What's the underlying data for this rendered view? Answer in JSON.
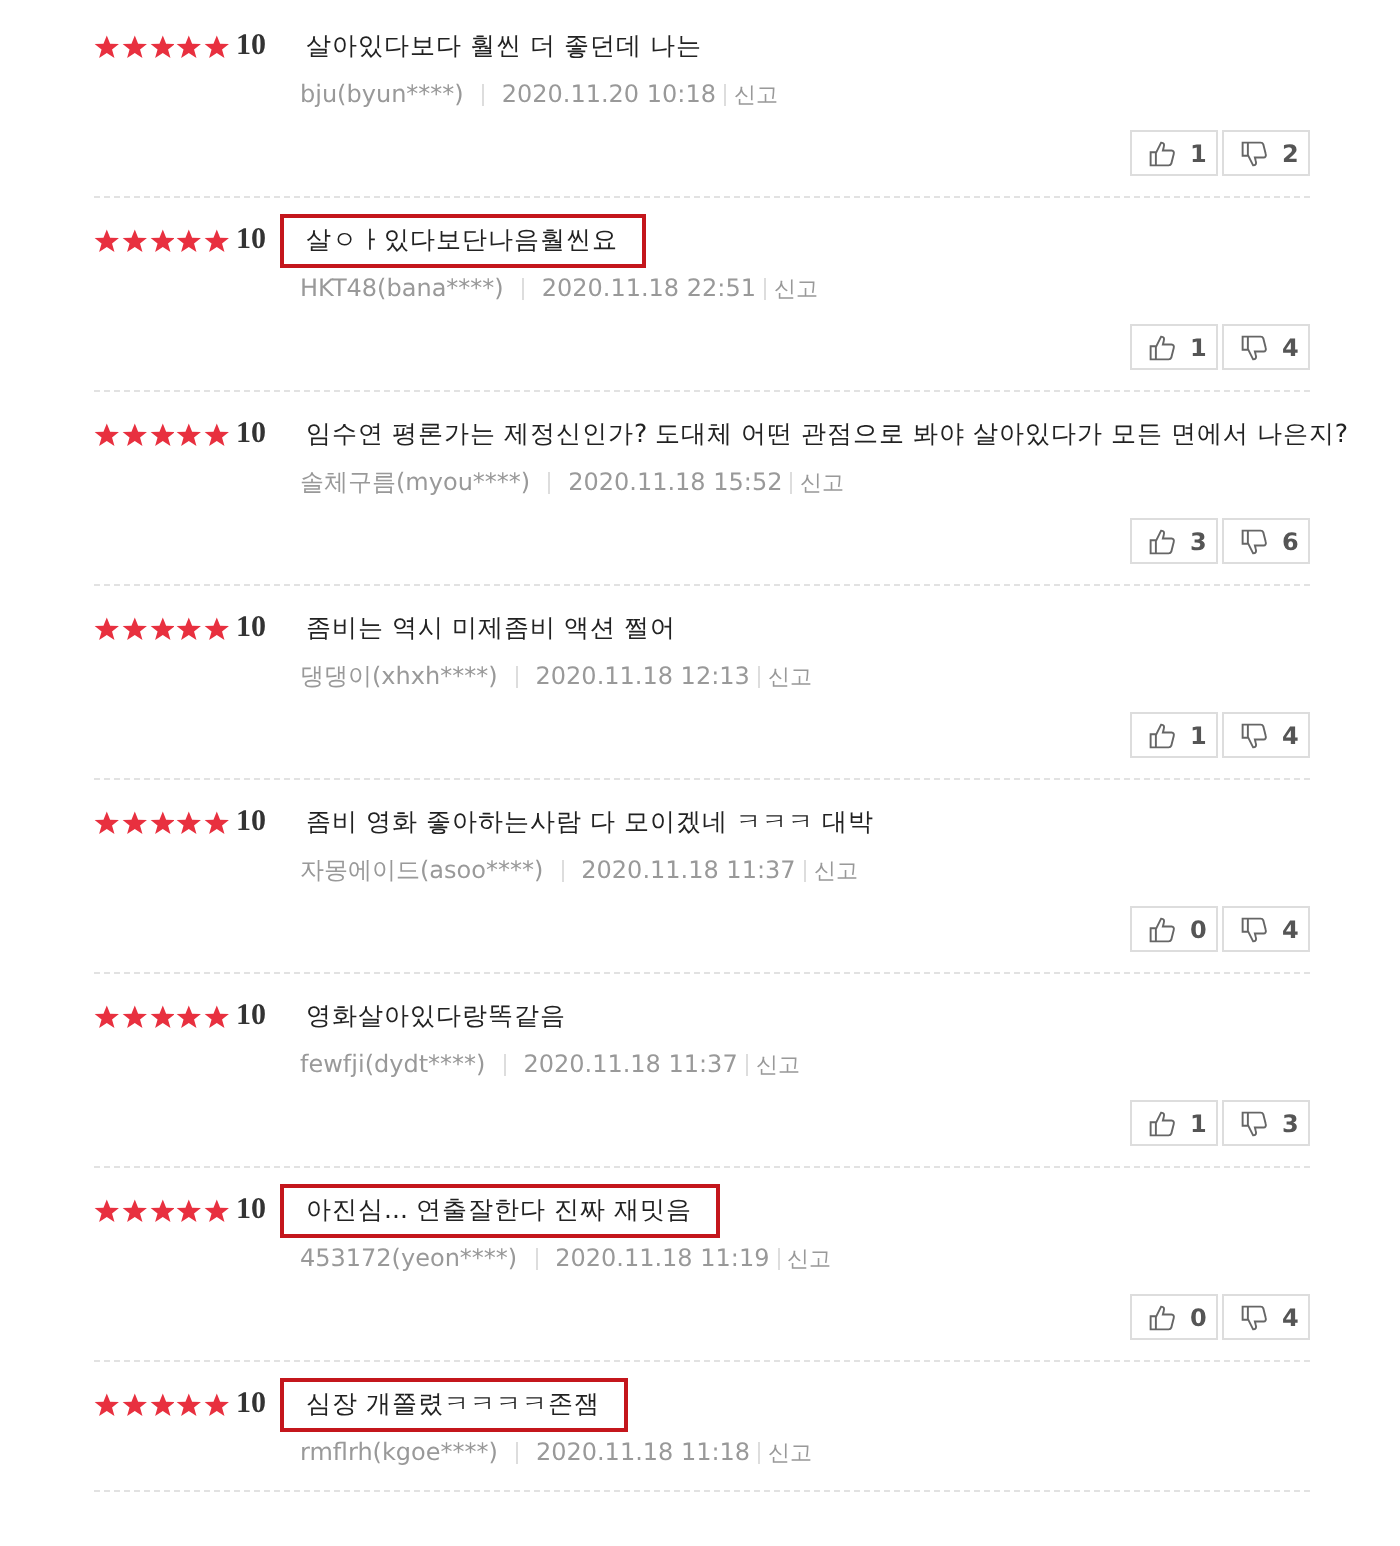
{
  "reviews": [
    {
      "stars": 5,
      "score": "10",
      "comment": "살아있다보다 훨씬 더 좋던데 나는",
      "highlighted": false,
      "author": "bju(byun****)",
      "date": "2020.11.20 10:18",
      "report": "신고",
      "likes": "1",
      "dislikes": "2"
    },
    {
      "stars": 5,
      "score": "10",
      "comment": "살ㅇㅏ있다보단나음훨씬요",
      "highlighted": true,
      "author": "HKT48(bana****)",
      "date": "2020.11.18 22:51",
      "report": "신고",
      "likes": "1",
      "dislikes": "4"
    },
    {
      "stars": 5,
      "score": "10",
      "comment": "임수연 평론가는 제정신인가? 도대체 어떤 관점으로 봐야 살아있다가 모든 면에서 나은지?",
      "highlighted": false,
      "author": "솔체구름(myou****)",
      "date": "2020.11.18 15:52",
      "report": "신고",
      "likes": "3",
      "dislikes": "6"
    },
    {
      "stars": 5,
      "score": "10",
      "comment": "좀비는 역시 미제좀비 액션 쩔어",
      "highlighted": false,
      "author": "댕댕이(xhxh****)",
      "date": "2020.11.18 12:13",
      "report": "신고",
      "likes": "1",
      "dislikes": "4"
    },
    {
      "stars": 5,
      "score": "10",
      "comment": "좀비 영화 좋아하는사람 다 모이겠네 ㅋㅋㅋ 대박",
      "highlighted": false,
      "author": "자몽에이드(asoo****)",
      "date": "2020.11.18 11:37",
      "report": "신고",
      "likes": "0",
      "dislikes": "4"
    },
    {
      "stars": 5,
      "score": "10",
      "comment": "영화살아있다랑똑같음",
      "highlighted": false,
      "author": "fewfji(dydt****)",
      "date": "2020.11.18 11:37",
      "report": "신고",
      "likes": "1",
      "dislikes": "3"
    },
    {
      "stars": 5,
      "score": "10",
      "comment": "아진심... 연출잘한다 진짜 재밋음",
      "highlighted": true,
      "author": "453172(yeon****)",
      "date": "2020.11.18 11:19",
      "report": "신고",
      "likes": "0",
      "dislikes": "4"
    },
    {
      "stars": 5,
      "score": "10",
      "comment": "심장 개쫄렸ㅋㅋㅋㅋ존잼",
      "highlighted": true,
      "author": "rmflrh(kgoe****)",
      "date": "2020.11.18 11:18",
      "report": "신고"
    }
  ]
}
